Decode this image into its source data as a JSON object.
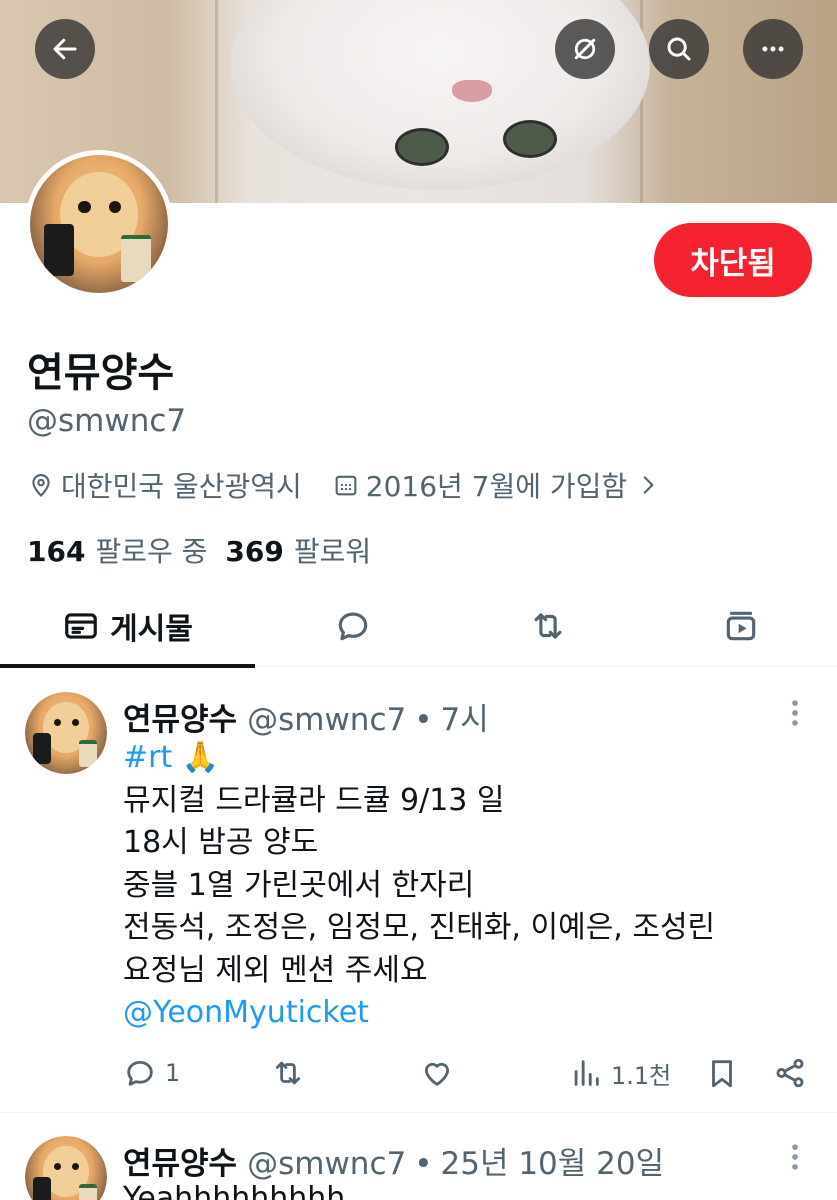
{
  "header": {
    "back_icon": "arrow-left-icon",
    "buttons": [
      "grok-icon",
      "search-icon",
      "more-icon"
    ]
  },
  "profile": {
    "display_name": "연뮤양수",
    "handle": "@smwnc7",
    "location": "대한민국 울산광역시",
    "joined": "2016년 7월에 가입함",
    "following_count": "164",
    "following_label": "팔로우 중",
    "followers_count": "369",
    "followers_label": "팔로워",
    "blocked_label": "차단됨"
  },
  "tabs": [
    {
      "label": "게시물",
      "icon": "posts-icon",
      "active": true
    },
    {
      "label": "",
      "icon": "replies-icon",
      "active": false
    },
    {
      "label": "",
      "icon": "reposts-icon",
      "active": false
    },
    {
      "label": "",
      "icon": "media-icon",
      "active": false
    }
  ],
  "tweets": [
    {
      "name": "연뮤양수",
      "handle": "@smwnc7",
      "dot": "•",
      "time": "7시",
      "hashtag": "#rt",
      "emoji": "🙏",
      "lines": [
        "뮤지컬 드라큘라 드큘 9/13 일",
        "18시 밤공 양도",
        "중블 1열 가린곳에서 한자리",
        "전동석, 조정은, 임정모, 진태화, 이예은, 조성린",
        "요정님 제외 멘션 주세요"
      ],
      "mention": "@YeonMyuticket",
      "reply_count": "1",
      "views": "1.1천"
    },
    {
      "name": "연뮤양수",
      "handle": "@smwnc7",
      "dot": "•",
      "time": "25년 10월 20일",
      "text": "Yeahhhhhhhhh"
    }
  ],
  "colors": {
    "accent": "#1d9bf0",
    "blocked": "#f4212e",
    "text": "#0f1419",
    "secondary": "#536471"
  }
}
